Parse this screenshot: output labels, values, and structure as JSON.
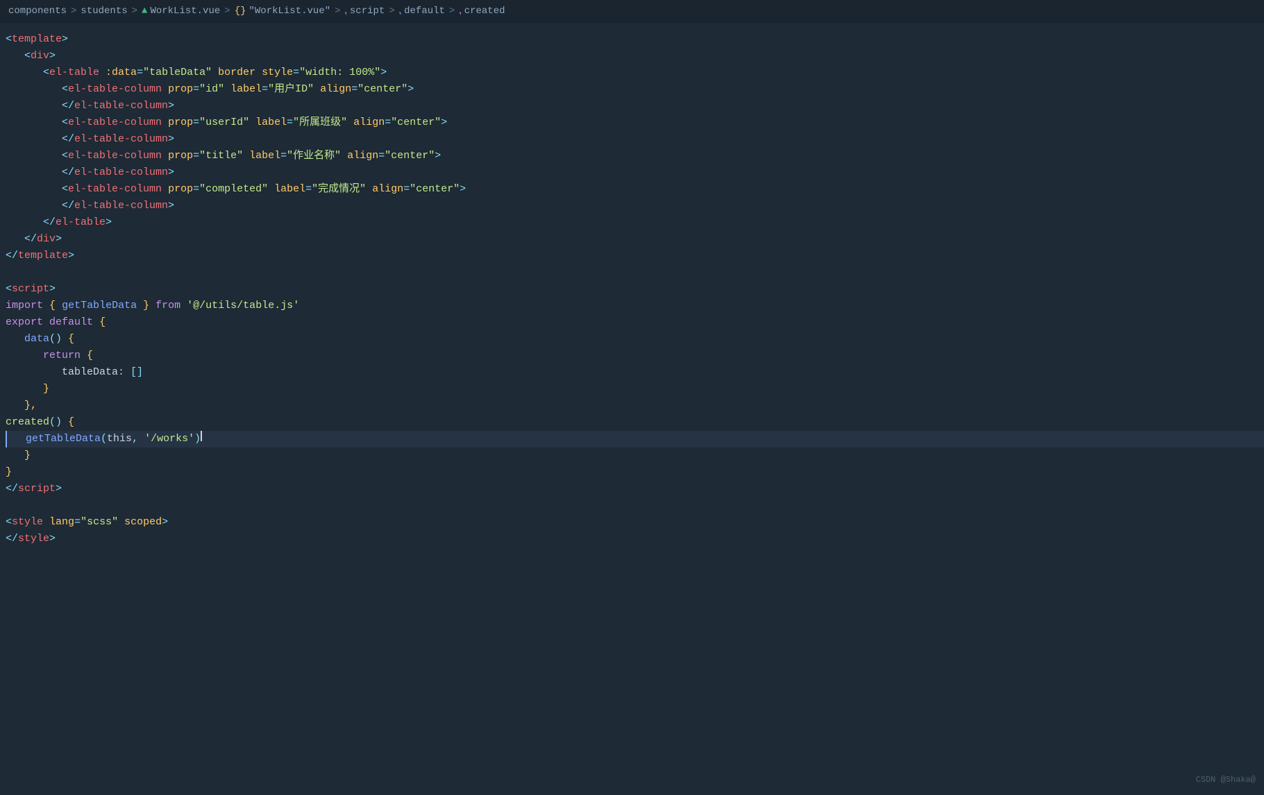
{
  "breadcrumb": {
    "components": "components",
    "sep1": ">",
    "students": "students",
    "sep2": ">",
    "vue_icon": "V",
    "worklist_vue": "WorkList.vue",
    "sep3": ">",
    "braces": "{}",
    "worklist_vue2": "\"WorkList.vue\"",
    "sep4": ">",
    "script_icon": "</>",
    "script": "script",
    "sep5": ">",
    "default_icon": "[d]",
    "default": "default",
    "sep6": ">",
    "created_icon": "[c]",
    "created": "created"
  },
  "watermark": "CSDN @Shaka@"
}
